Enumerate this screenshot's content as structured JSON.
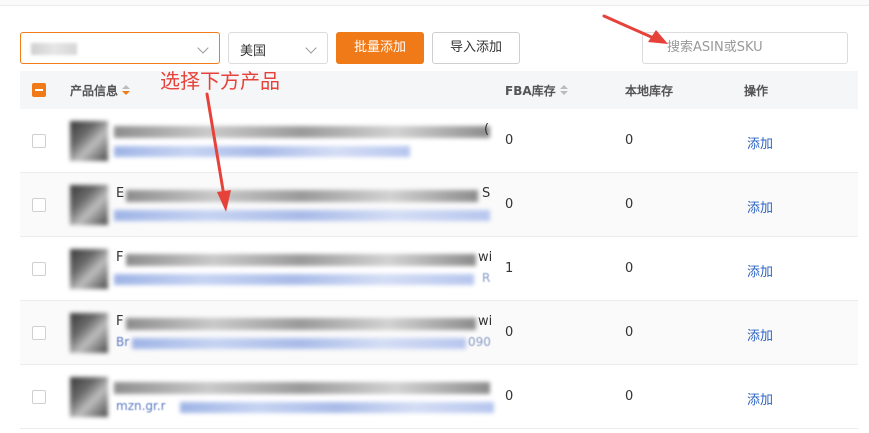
{
  "toolbar": {
    "country_value": "美国",
    "bulk_add_label": "批量添加",
    "import_add_label": "导入添加",
    "search_placeholder": "搜索ASIN或SKU"
  },
  "table": {
    "headers": {
      "product_info": "产品信息",
      "fba_stock": "FBA库存",
      "local_stock": "本地库存",
      "actions": "操作"
    },
    "rows": [
      {
        "title_prefix": "",
        "title_suffix": "(",
        "link_prefix": "",
        "link_suffix": "",
        "fba": "0",
        "local": "0",
        "action": "添加"
      },
      {
        "title_prefix": "E",
        "title_suffix": "S",
        "link_prefix": "",
        "link_suffix": "",
        "fba": "0",
        "local": "0",
        "action": "添加"
      },
      {
        "title_prefix": "F",
        "title_suffix": "wi",
        "link_prefix": "",
        "link_suffix": "R",
        "fba": "1",
        "local": "0",
        "action": "添加"
      },
      {
        "title_prefix": "F",
        "title_suffix": "wi",
        "link_prefix": "Br",
        "link_suffix": "090",
        "fba": "0",
        "local": "0",
        "action": "添加"
      },
      {
        "title_prefix": "",
        "title_suffix": "",
        "link_prefix": "mzn.gr.r",
        "link_suffix": "",
        "fba": "0",
        "local": "0",
        "action": "添加"
      }
    ]
  },
  "annotation": {
    "text": "选择下方产品",
    "color": "#e7423a"
  },
  "colors": {
    "accent": "#f07a18",
    "link": "#2b64c4"
  }
}
